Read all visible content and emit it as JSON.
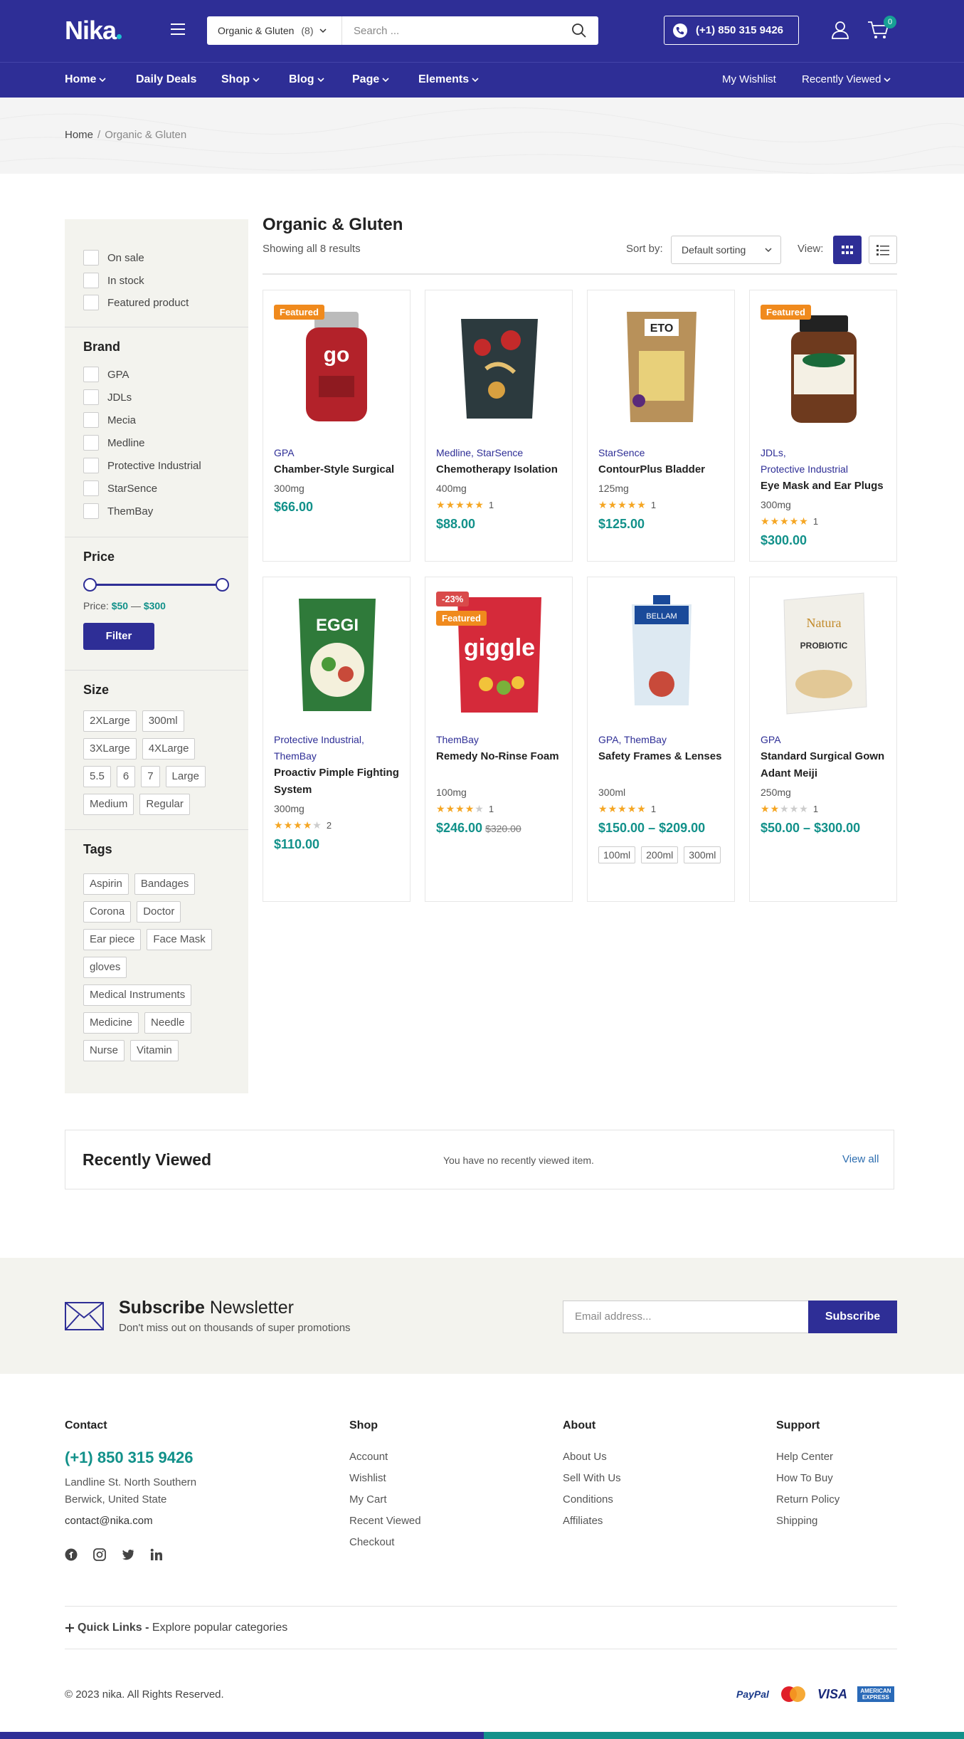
{
  "header": {
    "logo": "Nika",
    "search": {
      "category": "Organic & Gluten",
      "count": "(8)",
      "placeholder": "Search ..."
    },
    "phone": "(+1) 850 315 9426",
    "cart_count": "0",
    "nav": [
      {
        "label": "Home"
      },
      {
        "label": "Daily Deals"
      },
      {
        "label": "Shop"
      },
      {
        "label": "Blog"
      },
      {
        "label": "Page"
      },
      {
        "label": "Elements"
      }
    ],
    "wishlist": "My Wishlist",
    "recently_viewed": "Recently Viewed"
  },
  "breadcrumb": {
    "home": "Home",
    "sep": "/",
    "current": "Organic & Gluten"
  },
  "sidebar": {
    "filters": [
      "On sale",
      "In stock",
      "Featured product"
    ],
    "brand_title": "Brand",
    "brands": [
      "GPA",
      "JDLs",
      "Mecia",
      "Medline",
      "Protective Industrial",
      "StarSence",
      "ThemBay"
    ],
    "price_title": "Price",
    "price_label": "Price:",
    "price_min": "$50",
    "price_dash": "—",
    "price_max": "$300",
    "filter_button": "Filter",
    "size_title": "Size",
    "sizes": [
      [
        "2XLarge",
        "300ml"
      ],
      [
        "3XLarge",
        "4XLarge"
      ],
      [
        "5.5",
        "6",
        "7",
        "Large"
      ],
      [
        "Medium",
        "Regular"
      ]
    ],
    "tags_title": "Tags",
    "tags": [
      [
        "Aspirin",
        "Bandages"
      ],
      [
        "Corona",
        "Doctor"
      ],
      [
        "Ear piece",
        "Face Mask"
      ],
      [
        "gloves"
      ],
      [
        "Medical Instruments"
      ],
      [
        "Medicine",
        "Needle"
      ],
      [
        "Nurse",
        "Vitamin"
      ]
    ]
  },
  "content": {
    "title": "Organic & Gluten",
    "showing": "Showing all 8 results",
    "sort_label": "Sort by:",
    "sort_value": "Default sorting",
    "view_label": "View:"
  },
  "products": [
    {
      "badge": "Featured",
      "brand": "GPA",
      "name": "Chamber-Style Surgical",
      "size": "300mg",
      "rating": null,
      "reviews": "",
      "price": "$66.00",
      "old_price": ""
    },
    {
      "badge": "",
      "brand": "Medline, StarSence",
      "name": "Chemotherapy Isolation",
      "size": "400mg",
      "rating": 5,
      "reviews": "1",
      "price": "$88.00",
      "old_price": ""
    },
    {
      "badge": "",
      "brand": "StarSence",
      "name": "ContourPlus Bladder",
      "size": "125mg",
      "rating": 5,
      "reviews": "1",
      "price": "$125.00",
      "old_price": ""
    },
    {
      "badge": "Featured",
      "brand": "JDLs,\nProtective Industrial",
      "name": "Eye Mask and Ear Plugs",
      "size": "300mg",
      "rating": 5,
      "reviews": "1",
      "price": "$300.00",
      "old_price": ""
    },
    {
      "badge": "",
      "brand": "Protective Industrial,\nThemBay",
      "name": "Proactiv Pimple Fighting System",
      "size": "300mg",
      "rating": 4,
      "reviews": "2",
      "price": "$110.00",
      "old_price": ""
    },
    {
      "badge": "Featured",
      "sale": "-23%",
      "brand": "ThemBay",
      "name": "Remedy No-Rinse Foam",
      "size": "100mg",
      "rating": 4,
      "reviews": "1",
      "price": "$246.00",
      "old_price": "$320.00"
    },
    {
      "badge": "",
      "brand": "GPA, ThemBay",
      "name": "Safety Frames & Lenses",
      "size": "300ml",
      "rating": 5,
      "reviews": "1",
      "price": "$150.00 – $209.00",
      "old_price": "",
      "options": [
        "100ml",
        "200ml",
        "300ml"
      ]
    },
    {
      "badge": "",
      "brand": "GPA",
      "name": "Standard Surgical Gown Adant Meiji",
      "size": "250mg",
      "rating": 2,
      "reviews": "1",
      "price": "$50.00 – $300.00",
      "old_price": ""
    }
  ],
  "recent": {
    "title": "Recently Viewed",
    "empty": "You have no recently viewed item.",
    "view_all": "View all"
  },
  "newsletter": {
    "title_bold": "Subscribe",
    "title_rest": "Newsletter",
    "subtitle": "Don't miss out on thousands of super promotions",
    "placeholder": "Email address...",
    "button": "Subscribe"
  },
  "footer": {
    "contact_title": "Contact",
    "phone": "(+1) 850 315 9426",
    "address1": "Landline St. North Southern",
    "address2": "Berwick, United State",
    "email": "contact@nika.com",
    "shop_title": "Shop",
    "shop_links": [
      "Account",
      "Wishlist",
      "My Cart",
      "Recent Viewed",
      "Checkout"
    ],
    "about_title": "About",
    "about_links": [
      "About Us",
      "Sell With Us",
      "Conditions",
      "Affiliates"
    ],
    "support_title": "Support",
    "support_links": [
      "Help Center",
      "How To Buy",
      "Return Policy",
      "Shipping"
    ],
    "quick_links_bold": "Quick Links -",
    "quick_links_rest": "Explore popular categories",
    "copyright": "© 2023 nika. All Rights Reserved.",
    "payments": [
      "PayPal",
      "MasterCard",
      "VISA",
      "AMERICAN EXPRESS"
    ]
  },
  "colors": {
    "brand": "#2e2e96",
    "accent": "#12918a",
    "featured": "#f08a1d",
    "sale": "#d94a4a",
    "star": "#f5a623"
  }
}
